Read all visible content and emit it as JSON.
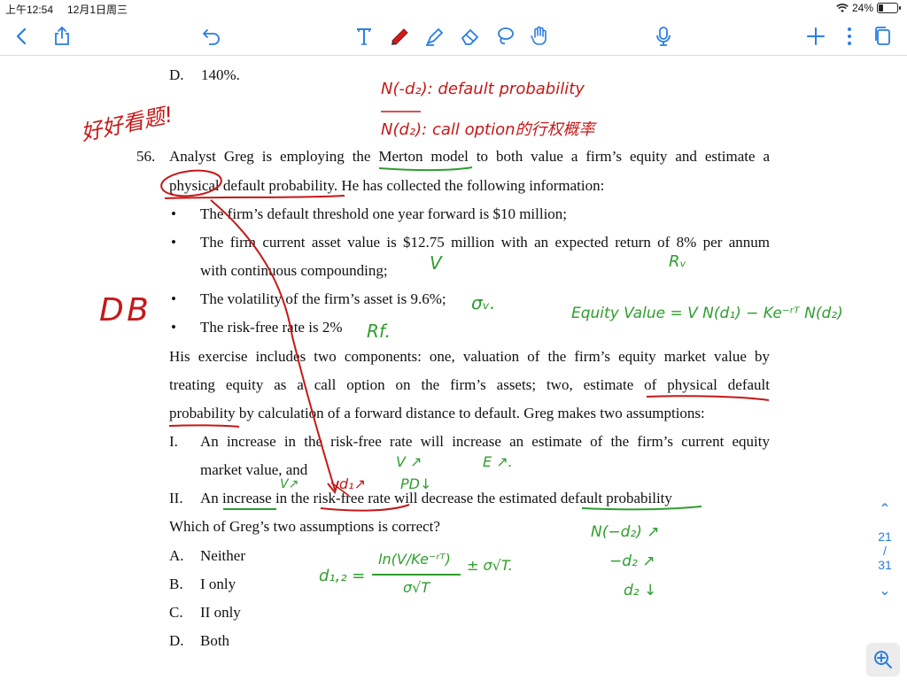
{
  "status_bar": {
    "time": "上午12:54",
    "date": "12月1日周三",
    "battery": "24%",
    "battery_level": 0.24
  },
  "toolbar": {
    "icons": [
      "back-icon",
      "share-icon",
      "undo-icon",
      "text-tool-icon",
      "pen-icon",
      "highlighter-icon",
      "eraser-icon",
      "lasso-icon",
      "hand-icon",
      "microphone-icon",
      "add-icon",
      "more-icon",
      "pages-icon"
    ]
  },
  "document": {
    "prev_option": {
      "letter": "D.",
      "text": "140%."
    },
    "question_number": "56.",
    "stem_lines": [
      "Analyst Greg is employing the Merton model to both value a firm’s equity and estimate a",
      "physical default probability. He has collected the following information:"
    ],
    "bullets": [
      "The firm’s default threshold one year forward is $10 million;",
      "The firm current asset value is $12.75 million with an expected return of 8% per annum",
      "with continuous compounding;",
      "The volatility of the firm’s asset is 9.6%;",
      "The risk-free rate is 2%"
    ],
    "exercise_lines": [
      "His exercise includes two components: one, valuation of the firm’s equity market value by",
      "treating equity as a call option on the firm’s assets; two, estimate of physical default",
      "probability by calculation of a forward distance to default. Greg makes two assumptions:"
    ],
    "assumptions": [
      {
        "numeral": "I.",
        "line1": "An increase in the risk-free rate will increase an estimate of the firm’s current equity",
        "line2": "market value, and"
      },
      {
        "numeral": "II.",
        "line1": "An increase in the risk-free rate will decrease the estimated default probability"
      }
    ],
    "question": "Which of Greg’s two assumptions is correct?",
    "options": [
      {
        "letter": "A.",
        "text": "Neither"
      },
      {
        "letter": "B.",
        "text": "I only"
      },
      {
        "letter": "C.",
        "text": "II only"
      },
      {
        "letter": "D.",
        "text": "Both"
      }
    ]
  },
  "annotations": {
    "red": {
      "top_note_1": "N(-d₂): default probability",
      "top_note_2": "N(d₂): call option的行权概率",
      "left_note": "好好看题!",
      "answer": "D B",
      "d1_arrow": "d₁↗",
      "pd_down": "PD↓"
    },
    "green": {
      "v": "V",
      "ru": "Rᵥ",
      "sigma_v": "σᵥ.",
      "rf": "Rf.",
      "equity_value": "Equity Value = V N(d₁) − Ke⁻ʳᵀ N(d₂)",
      "v_up": "V ↗",
      "e_up": "E ↗.",
      "v_up2": "V↗",
      "formula_lhs": "d₁,₂ =",
      "formula_num": "ln(V/Ke⁻ʳᵀ)",
      "formula_den": "σ√T",
      "formula_tail": "± σ√T.",
      "n_neg_d2": "N(−d₂) ↗",
      "neg_d2": "−d₂ ↗",
      "d2_down": "d₂ ↓"
    }
  },
  "pager": {
    "current": "21",
    "separator": "/",
    "total": "31"
  }
}
